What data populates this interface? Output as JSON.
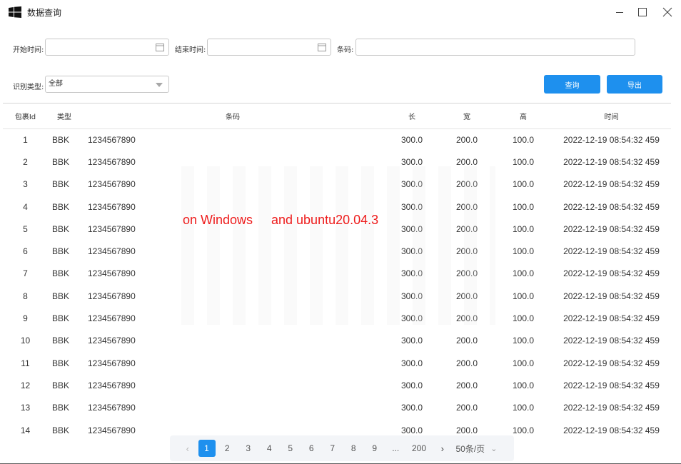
{
  "window": {
    "title": "数据查询"
  },
  "filters": {
    "start_label": "开始时间:",
    "start_value": "",
    "end_label": "结束时间:",
    "end_value": "",
    "barcode_label": "条码:",
    "barcode_value": "",
    "type_label": "识别类型:",
    "type_value": "全部"
  },
  "actions": {
    "query_label": "查询",
    "export_label": "导出"
  },
  "table": {
    "columns": [
      "包裹Id",
      "类型",
      "条码",
      "长",
      "宽",
      "高",
      "时间"
    ],
    "rows": [
      [
        "1",
        "BBK",
        "1234567890",
        "300.0",
        "200.0",
        "100.0",
        "2022-12-19 08:54:32 459"
      ],
      [
        "2",
        "BBK",
        "1234567890",
        "300.0",
        "200.0",
        "100.0",
        "2022-12-19 08:54:32 459"
      ],
      [
        "3",
        "BBK",
        "1234567890",
        "300.0",
        "200.0",
        "100.0",
        "2022-12-19 08:54:32 459"
      ],
      [
        "4",
        "BBK",
        "1234567890",
        "300.0",
        "200.0",
        "100.0",
        "2022-12-19 08:54:32 459"
      ],
      [
        "5",
        "BBK",
        "1234567890",
        "300.0",
        "200.0",
        "100.0",
        "2022-12-19 08:54:32 459"
      ],
      [
        "6",
        "BBK",
        "1234567890",
        "300.0",
        "200.0",
        "100.0",
        "2022-12-19 08:54:32 459"
      ],
      [
        "7",
        "BBK",
        "1234567890",
        "300.0",
        "200.0",
        "100.0",
        "2022-12-19 08:54:32 459"
      ],
      [
        "8",
        "BBK",
        "1234567890",
        "300.0",
        "200.0",
        "100.0",
        "2022-12-19 08:54:32 459"
      ],
      [
        "9",
        "BBK",
        "1234567890",
        "300.0",
        "200.0",
        "100.0",
        "2022-12-19 08:54:32 459"
      ],
      [
        "10",
        "BBK",
        "1234567890",
        "300.0",
        "200.0",
        "100.0",
        "2022-12-19 08:54:32 459"
      ],
      [
        "11",
        "BBK",
        "1234567890",
        "300.0",
        "200.0",
        "100.0",
        "2022-12-19 08:54:32 459"
      ],
      [
        "12",
        "BBK",
        "1234567890",
        "300.0",
        "200.0",
        "100.0",
        "2022-12-19 08:54:32 459"
      ],
      [
        "13",
        "BBK",
        "1234567890",
        "300.0",
        "200.0",
        "100.0",
        "2022-12-19 08:54:32 459"
      ],
      [
        "14",
        "BBK",
        "1234567890",
        "300.0",
        "200.0",
        "100.0",
        "2022-12-19 08:54:32 459"
      ]
    ]
  },
  "overlay": {
    "text_left": "on Windows",
    "text_right": "and ubuntu20.04.3",
    "color": "#ee1c1c"
  },
  "pagination": {
    "prev_icon": "chevron-left-icon",
    "pages": [
      "1",
      "2",
      "3",
      "4",
      "5",
      "6",
      "7",
      "8",
      "9"
    ],
    "current": "1",
    "ellipsis": "...",
    "last": "200",
    "next_icon": "chevron-right-icon",
    "page_size": "50条/页"
  },
  "colors": {
    "accent": "#1e90ee"
  }
}
